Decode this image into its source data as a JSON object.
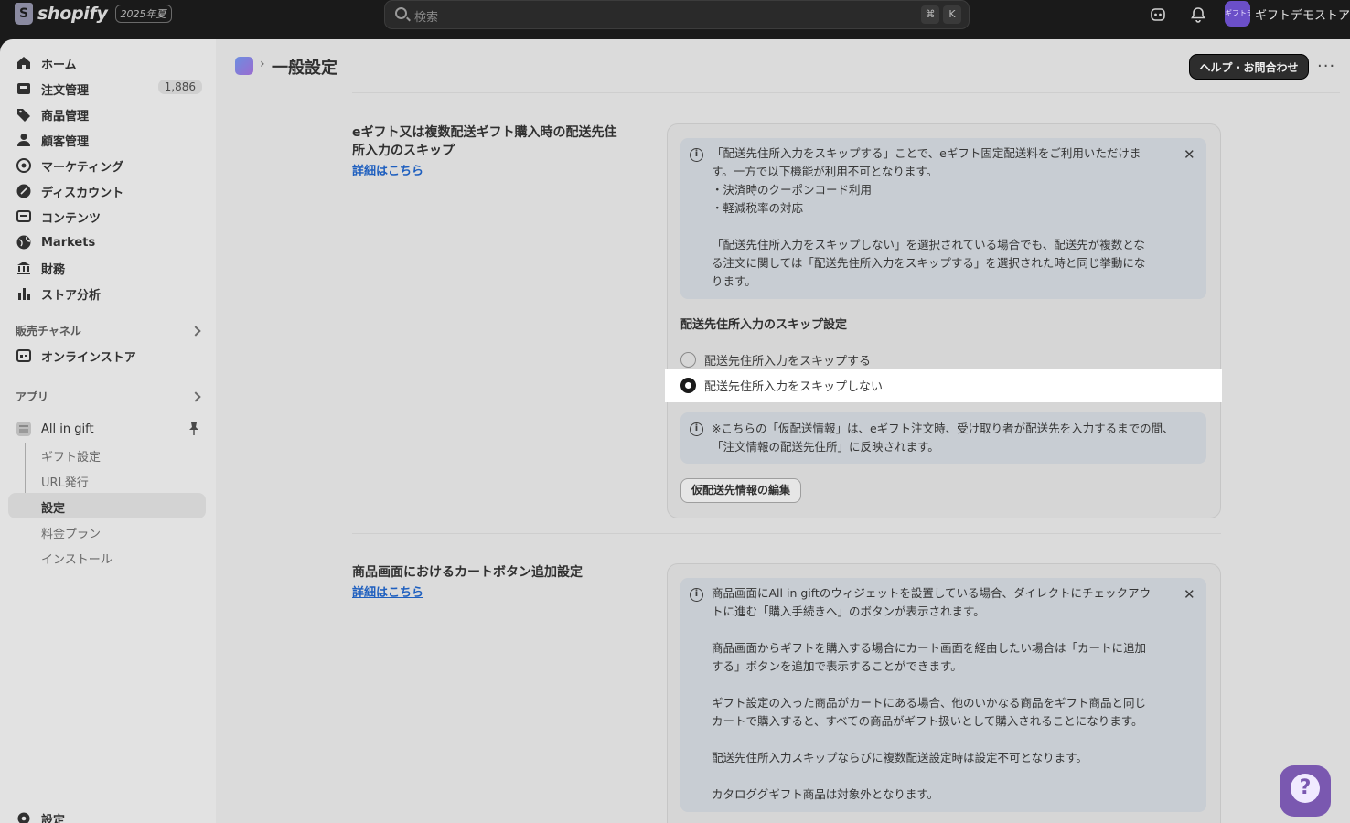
{
  "topbar": {
    "logo_text": "shopify",
    "edition_badge": "2025年夏",
    "search_placeholder": "検索",
    "shortcut_key1": "⌘",
    "shortcut_key2": "K",
    "avatar_text": "ギフトデモ",
    "store_name": "ギフトデモストア"
  },
  "sidebar": {
    "items": [
      {
        "label": "ホーム",
        "icon": "home-icon"
      },
      {
        "label": "注文管理",
        "icon": "inbox-icon",
        "count": "1,886"
      },
      {
        "label": "商品管理",
        "icon": "tag-icon"
      },
      {
        "label": "顧客管理",
        "icon": "person-icon"
      },
      {
        "label": "マーケティング",
        "icon": "target-icon"
      },
      {
        "label": "ディスカウント",
        "icon": "discount-icon"
      },
      {
        "label": "コンテンツ",
        "icon": "content-icon"
      },
      {
        "label": "Markets",
        "icon": "globe-icon"
      },
      {
        "label": "財務",
        "icon": "bank-icon"
      },
      {
        "label": "ストア分析",
        "icon": "bar-chart-icon"
      }
    ],
    "sales_channels_title": "販売チャネル",
    "online_store": "オンラインストア",
    "apps_title": "アプリ",
    "app_name": "All in gift",
    "app_sub_items": [
      "ギフト設定",
      "URL発行",
      "設定",
      "料金プラン",
      "インストール"
    ],
    "settings": "設定"
  },
  "header": {
    "breadcrumb_sep": "›",
    "title": "一般設定",
    "help_button": "ヘルプ・お問合わせ",
    "more": "···"
  },
  "section1": {
    "heading_line1": "eギフト又は複数配送ギフト購入時の配送先住",
    "heading_line2": "所入力のスキップ",
    "link": "詳細はこちら",
    "banner_text": "「配送先住所入力をスキップする」ことで、eギフト固定配送料をご利用いただけま\nす。一方で以下機能が利用不可となります。\n・決済時のクーポンコード利用\n・軽減税率の対応\n\n「配送先住所入力をスキップしない」を選択されている場合でも、配送先が複数とな\nる注文に関しては「配送先住所入力をスキップする」を選択された時と同じ挙動にな\nります。",
    "subheading": "配送先住所入力のスキップ設定",
    "options": [
      "配送先住所入力をスキップする",
      "配送先住所入力をスキップしない"
    ],
    "selected_option": "配送先住所入力をスキップしない",
    "note_text": "※こちらの「仮配送情報」は、eギフト注文時、受け取り者が配送先を入力するまでの間、\n「注文情報の配送先住所」に反映されます。",
    "edit_button": "仮配送先情報の編集"
  },
  "section2": {
    "heading": "商品画面におけるカートボタン追加設定",
    "link": "詳細はこちら",
    "banner_text": "商品画面にAll in giftのウィジェットを設置している場合、ダイレクトにチェックアウ\nトに進む「購入手続きへ」のボタンが表示されます。\n\n商品画面からギフトを購入する場合にカート画面を経由したい場合は「カートに追加\nする」ボタンを追加で表示することができます。\n\nギフト設定の入った商品がカートにある場合、他のいかなる商品をギフト商品と同じ\nカートで購入すると、すべての商品がギフト扱いとして購入されることになります。\n\n配送先住所入力スキップならびに複数配送設定時は設定不可となります。\n\nカタロググギフト商品は対象外となります。"
  },
  "colors": {
    "topbar_bg": "#1a1a1a",
    "accent_chat": "#7a58b0",
    "link": "#1e5fbf"
  }
}
